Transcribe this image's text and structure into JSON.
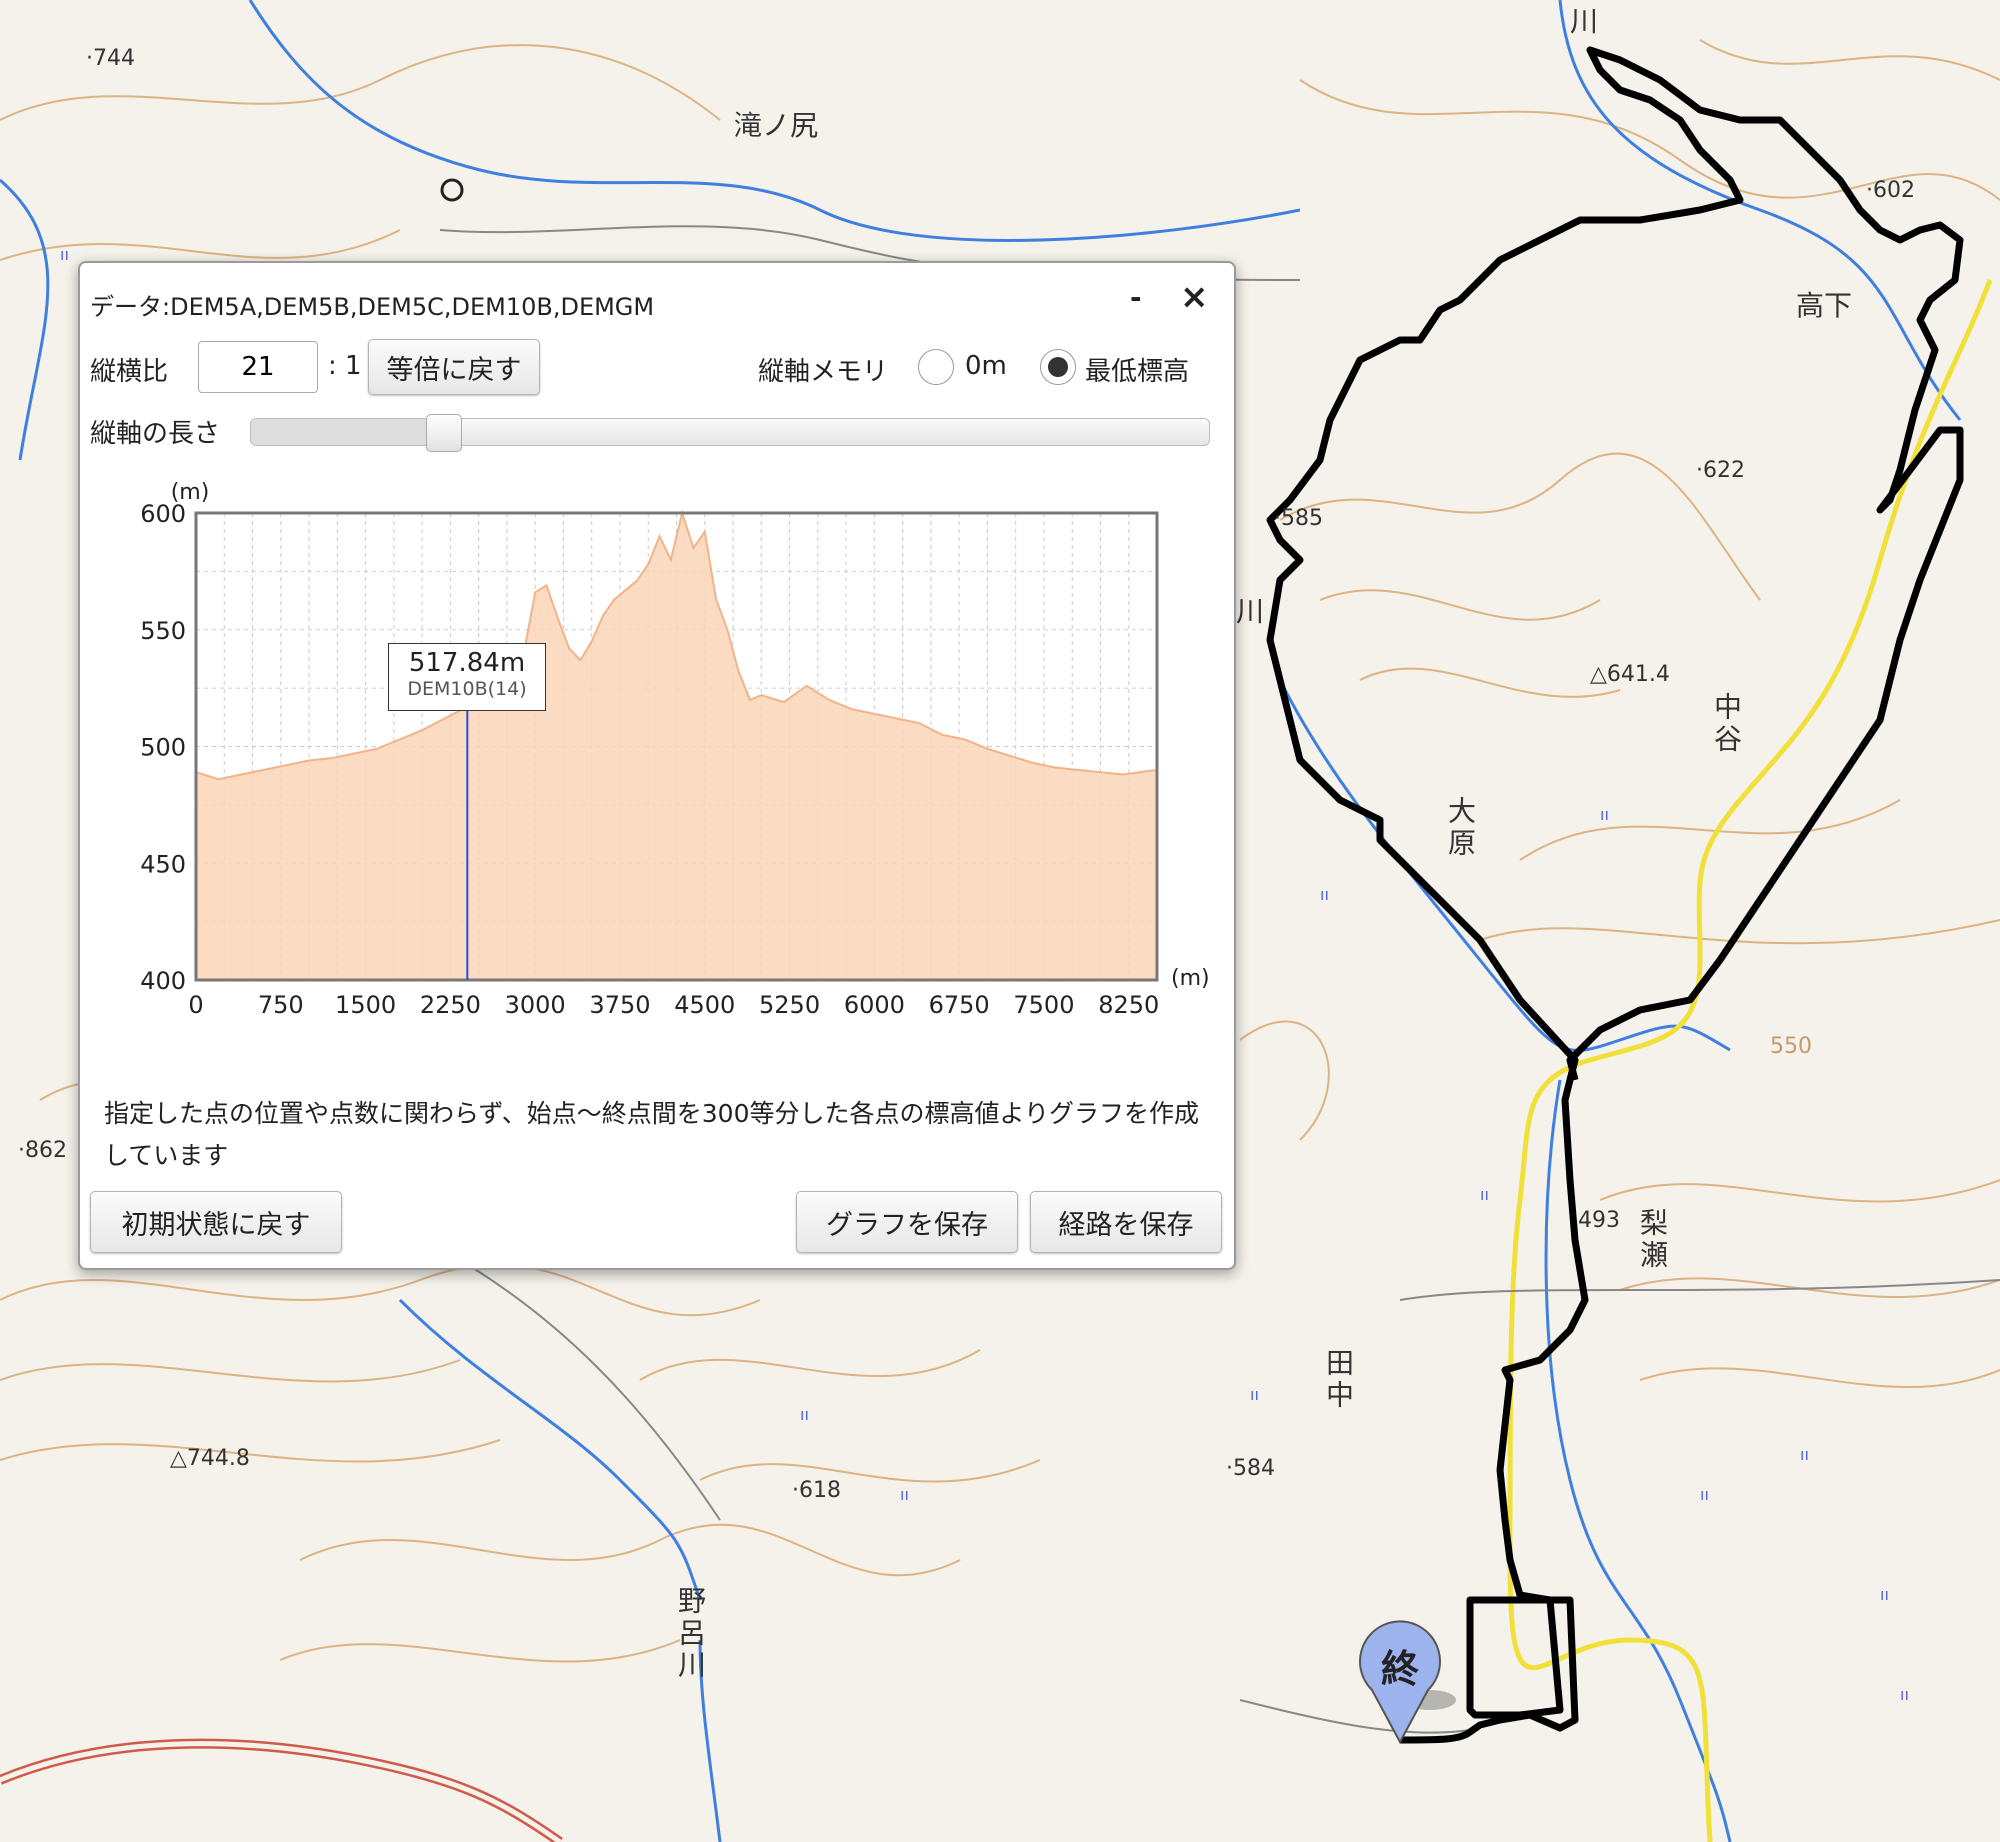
{
  "map": {
    "labels": [
      {
        "id": "elev-744",
        "text": "·744"
      },
      {
        "id": "place-takinoshiri",
        "text": "滝ノ尻"
      },
      {
        "id": "elev-602",
        "text": "·602"
      },
      {
        "id": "place-takashita",
        "text": "高下"
      },
      {
        "id": "elev-622",
        "text": "·622"
      },
      {
        "id": "elev-585",
        "text": "·585"
      },
      {
        "id": "triangulation-641",
        "text": "△641.4"
      },
      {
        "id": "place-nakatani",
        "text": "中谷"
      },
      {
        "id": "place-ohara",
        "text": "大原"
      },
      {
        "id": "elev-862",
        "text": "·862"
      },
      {
        "id": "elev-493",
        "text": "493"
      },
      {
        "id": "place-nasse",
        "text": "梨瀬"
      },
      {
        "id": "place-tanaka",
        "text": "田中"
      },
      {
        "id": "elev-584",
        "text": "·584"
      },
      {
        "id": "triangulation-744",
        "text": "△744.8"
      },
      {
        "id": "elev-618",
        "text": "·618"
      },
      {
        "id": "river-noro",
        "text": "野呂川"
      },
      {
        "id": "river-top",
        "text": "川"
      },
      {
        "id": "river-mid",
        "text": "川"
      },
      {
        "id": "contour-550",
        "text": "550"
      }
    ],
    "end_marker": "終",
    "route_color": "#000000",
    "road_color": "#f2e03a",
    "river_color": "#3f7fe0",
    "contour_color": "#d4a36a"
  },
  "panel": {
    "data_label": "データ:DEM5A,DEM5B,DEM5C,DEM10B,DEMGM",
    "minimize": "-",
    "close": "×",
    "ratio_label": "縦横比",
    "ratio_value": "21",
    "ratio_suffix": ": 1",
    "reset_scale_button": "等倍に戻す",
    "axis_memory_label": "縦軸メモリ",
    "option_0m": "0m",
    "option_min": "最低標高",
    "axis_length_label": "縦軸の長さ",
    "slider_value": 0.2,
    "note": "指定した点の位置や点数に関わらず、始点〜終点間を300等分した各点の標高値よりグラフを作成しています",
    "reset_button": "初期状態に戻す",
    "save_graph_button": "グラフを保存",
    "save_route_button": "経路を保存"
  },
  "chart_data": {
    "type": "area",
    "ylabel": "(m)",
    "xlabel": "(m)",
    "ylim": [
      400,
      600
    ],
    "xlim": [
      0,
      8500
    ],
    "yticks": [
      "600",
      "550",
      "500",
      "450",
      "400"
    ],
    "xticks": [
      "0",
      "750",
      "1500",
      "2250",
      "3000",
      "3750",
      "4500",
      "5250",
      "6000",
      "6750",
      "7500",
      "8250"
    ],
    "fill_color": "#fbd5b8",
    "line_color": "#f2b389",
    "cursor_x": 2400,
    "tooltip_value": "517.84m",
    "tooltip_source": "DEM10B(14)",
    "x": [
      0,
      200,
      400,
      600,
      800,
      1000,
      1200,
      1400,
      1600,
      1800,
      2000,
      2200,
      2400,
      2600,
      2800,
      2900,
      3000,
      3100,
      3200,
      3300,
      3400,
      3500,
      3600,
      3700,
      3800,
      3900,
      4000,
      4100,
      4200,
      4300,
      4400,
      4500,
      4600,
      4700,
      4800,
      4900,
      5000,
      5200,
      5400,
      5600,
      5800,
      6000,
      6200,
      6400,
      6600,
      6800,
      7000,
      7200,
      7400,
      7600,
      7800,
      8000,
      8200,
      8500
    ],
    "values": [
      489,
      486,
      488,
      490,
      492,
      494,
      495,
      497,
      499,
      503,
      507,
      512,
      517,
      522,
      527,
      540,
      566,
      569,
      555,
      542,
      537,
      545,
      556,
      563,
      567,
      571,
      578,
      590,
      580,
      600,
      585,
      592,
      563,
      550,
      532,
      520,
      522,
      519,
      526,
      520,
      516,
      514,
      512,
      510,
      505,
      503,
      499,
      496,
      493,
      491,
      490,
      489,
      488,
      490
    ]
  }
}
